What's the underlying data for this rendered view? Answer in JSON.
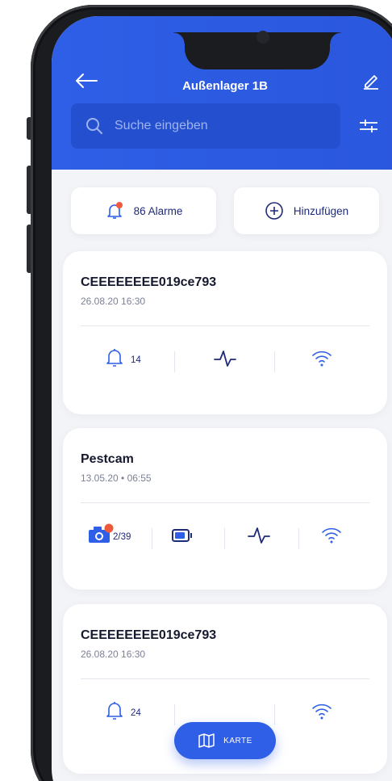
{
  "header": {
    "title": "Außenlager 1B",
    "search_placeholder": "Suche eingeben"
  },
  "actions": {
    "alarms_label": "86 Alarme",
    "add_label": "Hinzufügen"
  },
  "colors": {
    "primary": "#2e5fe6",
    "text": "#15192e",
    "accent_dot": "#ef5a3c"
  },
  "cards": [
    {
      "name": "CEEEEEEEE019ce793",
      "date": "26.08.20 16:30",
      "alarm_count": "14"
    },
    {
      "name": "Pestcam",
      "date": "13.05.20 • 06:55",
      "photo_count": "2/39"
    },
    {
      "name": "CEEEEEEEE019ce793",
      "date": "26.08.20 16:30",
      "alarm_count": "24"
    }
  ],
  "bottom": {
    "map_label": "KARTE"
  }
}
